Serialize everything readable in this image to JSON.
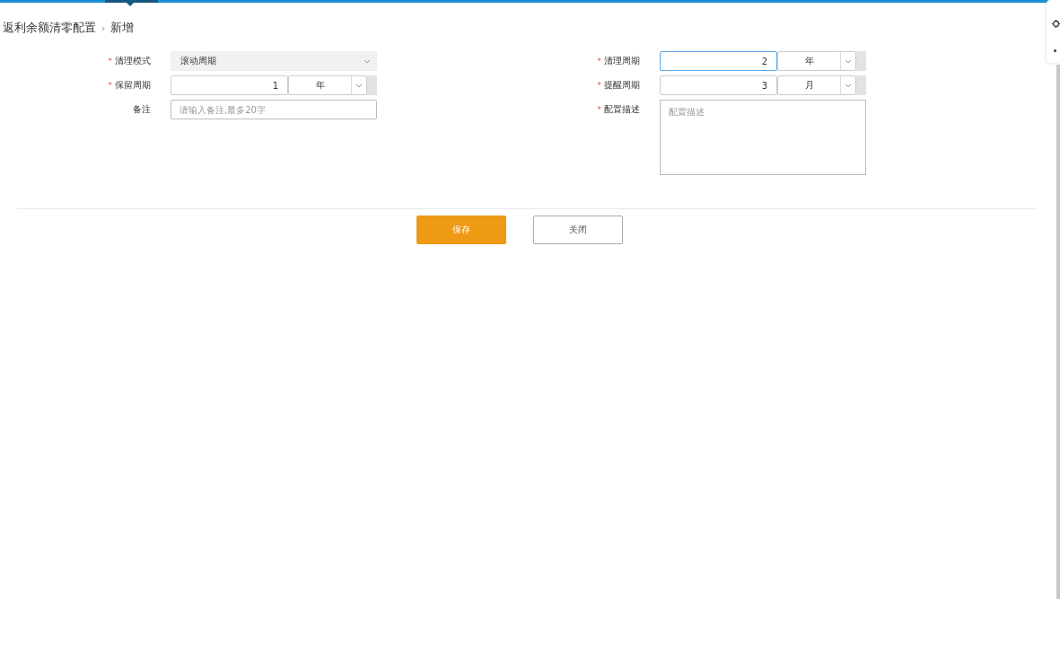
{
  "breadcrumb": {
    "parent": "返利余额清零配置",
    "separator": "›",
    "current": "新增"
  },
  "left_fields": [
    {
      "kind": "select",
      "label": "清理模式",
      "required_mark": "*",
      "value": "滚动周期",
      "disabled": true
    },
    {
      "kind": "number_unit",
      "label": "保留周期",
      "required_mark": "*",
      "value": "1",
      "unit": "年",
      "focused": false
    },
    {
      "kind": "text",
      "label": "备注",
      "placeholder": "请输入备注,最多20字"
    }
  ],
  "right_fields": [
    {
      "kind": "number_unit",
      "label": "清理周期",
      "required_mark": "*",
      "value": "2",
      "unit": "年",
      "focused": true
    },
    {
      "kind": "number_unit",
      "label": "提醒周期",
      "required_mark": "*",
      "value": "3",
      "unit": "月",
      "focused": false
    },
    {
      "kind": "textarea",
      "label": "配置描述",
      "required_mark": "*",
      "placeholder": "配置描述"
    }
  ],
  "buttons": [
    {
      "label": "保存",
      "kind": "primary"
    },
    {
      "label": "关闭",
      "kind": "secondary"
    }
  ]
}
